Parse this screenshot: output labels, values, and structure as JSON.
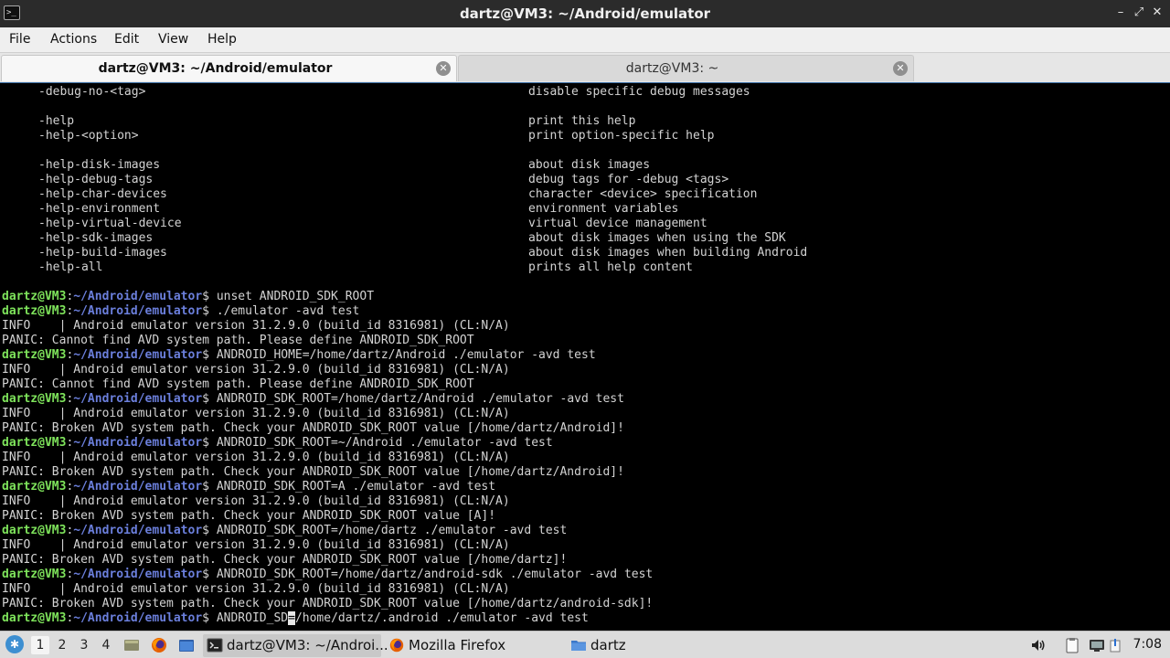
{
  "window": {
    "title": "dartz@VM3: ~/Android/emulator",
    "app_icon": "terminal-icon",
    "controls": [
      "minimize-icon",
      "maximize-icon",
      "close-icon"
    ]
  },
  "menu": {
    "file": "File",
    "actions": "Actions",
    "edit": "Edit",
    "view": "View",
    "help": "Help"
  },
  "tabs": [
    {
      "label": "dartz@VM3: ~/Android/emulator",
      "active": true
    },
    {
      "label": "dartz@VM3: ~",
      "active": false
    }
  ],
  "terminal": {
    "prompt_user": "dartz@VM3",
    "prompt_sep": ":",
    "prompt_path": "~/Android/emulator",
    "prompt_end": "$ ",
    "help_options": [
      {
        "opt": "-debug-no-<tag>",
        "desc": "disable specific debug messages"
      },
      {
        "opt": "",
        "desc": ""
      },
      {
        "opt": "-help",
        "desc": "print this help"
      },
      {
        "opt": "-help-<option>",
        "desc": "print option-specific help"
      },
      {
        "opt": "",
        "desc": ""
      },
      {
        "opt": "-help-disk-images",
        "desc": "about disk images"
      },
      {
        "opt": "-help-debug-tags",
        "desc": "debug tags for -debug <tags>"
      },
      {
        "opt": "-help-char-devices",
        "desc": "character <device> specification"
      },
      {
        "opt": "-help-environment",
        "desc": "environment variables"
      },
      {
        "opt": "-help-virtual-device",
        "desc": "virtual device management"
      },
      {
        "opt": "-help-sdk-images",
        "desc": "about disk images when using the SDK"
      },
      {
        "opt": "-help-build-images",
        "desc": "about disk images when building Android"
      },
      {
        "opt": "-help-all",
        "desc": "prints all help content"
      },
      {
        "opt": "",
        "desc": ""
      }
    ],
    "session": [
      {
        "type": "cmd",
        "text": "unset ANDROID_SDK_ROOT"
      },
      {
        "type": "cmd",
        "text": "./emulator -avd test"
      },
      {
        "type": "out",
        "text": "INFO    | Android emulator version 31.2.9.0 (build_id 8316981) (CL:N/A)"
      },
      {
        "type": "out",
        "text": "PANIC: Cannot find AVD system path. Please define ANDROID_SDK_ROOT"
      },
      {
        "type": "cmd",
        "text": "ANDROID_HOME=/home/dartz/Android ./emulator -avd test"
      },
      {
        "type": "out",
        "text": "INFO    | Android emulator version 31.2.9.0 (build_id 8316981) (CL:N/A)"
      },
      {
        "type": "out",
        "text": "PANIC: Cannot find AVD system path. Please define ANDROID_SDK_ROOT"
      },
      {
        "type": "cmd",
        "text": "ANDROID_SDK_ROOT=/home/dartz/Android ./emulator -avd test"
      },
      {
        "type": "out",
        "text": "INFO    | Android emulator version 31.2.9.0 (build_id 8316981) (CL:N/A)"
      },
      {
        "type": "out",
        "text": "PANIC: Broken AVD system path. Check your ANDROID_SDK_ROOT value [/home/dartz/Android]!"
      },
      {
        "type": "cmd",
        "text": "ANDROID_SDK_ROOT=~/Android ./emulator -avd test"
      },
      {
        "type": "out",
        "text": "INFO    | Android emulator version 31.2.9.0 (build_id 8316981) (CL:N/A)"
      },
      {
        "type": "out",
        "text": "PANIC: Broken AVD system path. Check your ANDROID_SDK_ROOT value [/home/dartz/Android]!"
      },
      {
        "type": "cmd",
        "text": "ANDROID_SDK_ROOT=A ./emulator -avd test"
      },
      {
        "type": "out",
        "text": "INFO    | Android emulator version 31.2.9.0 (build_id 8316981) (CL:N/A)"
      },
      {
        "type": "out",
        "text": "PANIC: Broken AVD system path. Check your ANDROID_SDK_ROOT value [A]!"
      },
      {
        "type": "cmd",
        "text": "ANDROID_SDK_ROOT=/home/dartz ./emulator -avd test"
      },
      {
        "type": "out",
        "text": "INFO    | Android emulator version 31.2.9.0 (build_id 8316981) (CL:N/A)"
      },
      {
        "type": "out",
        "text": "PANIC: Broken AVD system path. Check your ANDROID_SDK_ROOT value [/home/dartz]!"
      },
      {
        "type": "cmd",
        "text": "ANDROID_SDK_ROOT=/home/dartz/android-sdk ./emulator -avd test"
      },
      {
        "type": "out",
        "text": "INFO    | Android emulator version 31.2.9.0 (build_id 8316981) (CL:N/A)"
      },
      {
        "type": "out",
        "text": "PANIC: Broken AVD system path. Check your ANDROID_SDK_ROOT value [/home/dartz/android-sdk]!"
      }
    ],
    "current_input": {
      "before_cursor": "ANDROID_SD",
      "under_cursor": "=",
      "after_cursor": "/home/dartz/.android ./emulator -avd test"
    }
  },
  "taskbar": {
    "start_icon": "start-menu-icon",
    "workspaces": [
      "1",
      "2",
      "3",
      "4"
    ],
    "active_workspace": "1",
    "launchers": [
      "show-desktop-icon",
      "firefox-icon",
      "file-manager-icon"
    ],
    "tasks": [
      {
        "label": "dartz@VM3: ~/Androi...",
        "icon": "terminal-icon",
        "active": true
      },
      {
        "label": "Mozilla Firefox",
        "icon": "firefox-icon",
        "active": false
      },
      {
        "label": "dartz",
        "icon": "folder-icon",
        "active": false
      }
    ],
    "tray": [
      "volume-icon",
      "clipboard-icon",
      "network-icon"
    ],
    "clock": "7:08"
  },
  "colors": {
    "prompt_user": "#7ee35b",
    "prompt_path": "#6b7fdc",
    "terminal_bg": "#000000",
    "terminal_fg": "#d3d3d3"
  }
}
